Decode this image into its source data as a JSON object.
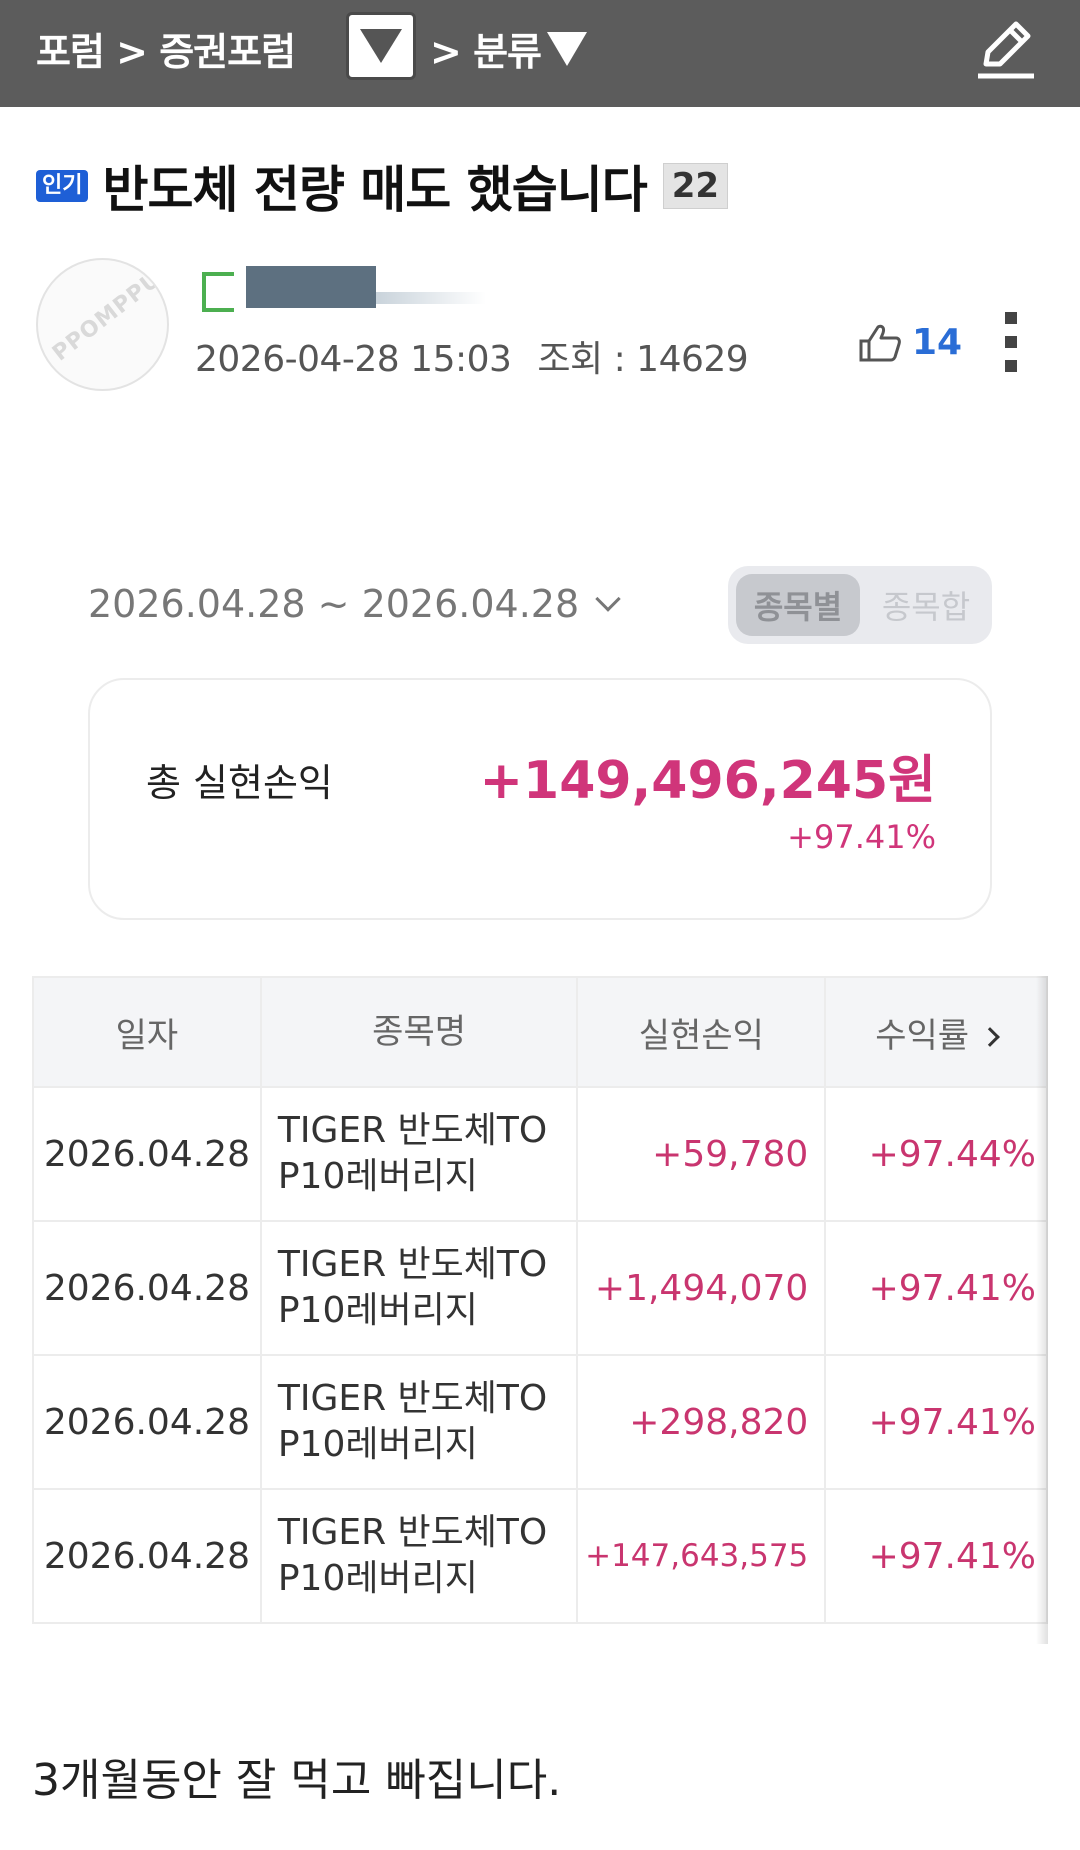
{
  "topbar": {
    "crumb_1": "포럼 > 증권포럼",
    "crumb_2": "> 분류",
    "dropdown_icon": "triangle-down-icon",
    "write_icon": "pencil-icon"
  },
  "post": {
    "badge": "인기",
    "title": "반도체 전량 매도 했습니다",
    "comment_count": "22",
    "avatar_text": "PPOMPPU",
    "datetime": "2026-04-28 15:03",
    "views": "조회 : 14629",
    "likes": "14",
    "body": "3개월동안 잘 먹고 빠집니다."
  },
  "account": {
    "period": "2026.04.28 ~ 2026.04.28",
    "seg_active": "종목별",
    "seg_inactive": "종목합",
    "summary_label": "총 실현손익",
    "summary_value": "+149,496,245원",
    "summary_rate": "+97.41%"
  },
  "table": {
    "headers": [
      "일자",
      "종목명",
      "실현손익",
      "수익률"
    ],
    "rows": [
      {
        "date": "2026.04.28",
        "name_1": "TIGER 반도체TO",
        "name_2": "P10레버리지",
        "pnl": "+59,780",
        "rate": "+97.44%"
      },
      {
        "date": "2026.04.28",
        "name_1": "TIGER 반도체TO",
        "name_2": "P10레버리지",
        "pnl": "+1,494,070",
        "rate": "+97.41%"
      },
      {
        "date": "2026.04.28",
        "name_1": "TIGER 반도체TO",
        "name_2": "P10레버리지",
        "pnl": "+298,820",
        "rate": "+97.41%"
      },
      {
        "date": "2026.04.28",
        "name_1": "TIGER 반도체TO",
        "name_2": "P10레버리지",
        "pnl": "+147,643,575",
        "rate": "+97.41%"
      }
    ]
  },
  "colors": {
    "topbar": "#5c5c5c",
    "badge": "#1e5fd6",
    "profit": "#d0357a",
    "likes": "#2a6dd6"
  }
}
